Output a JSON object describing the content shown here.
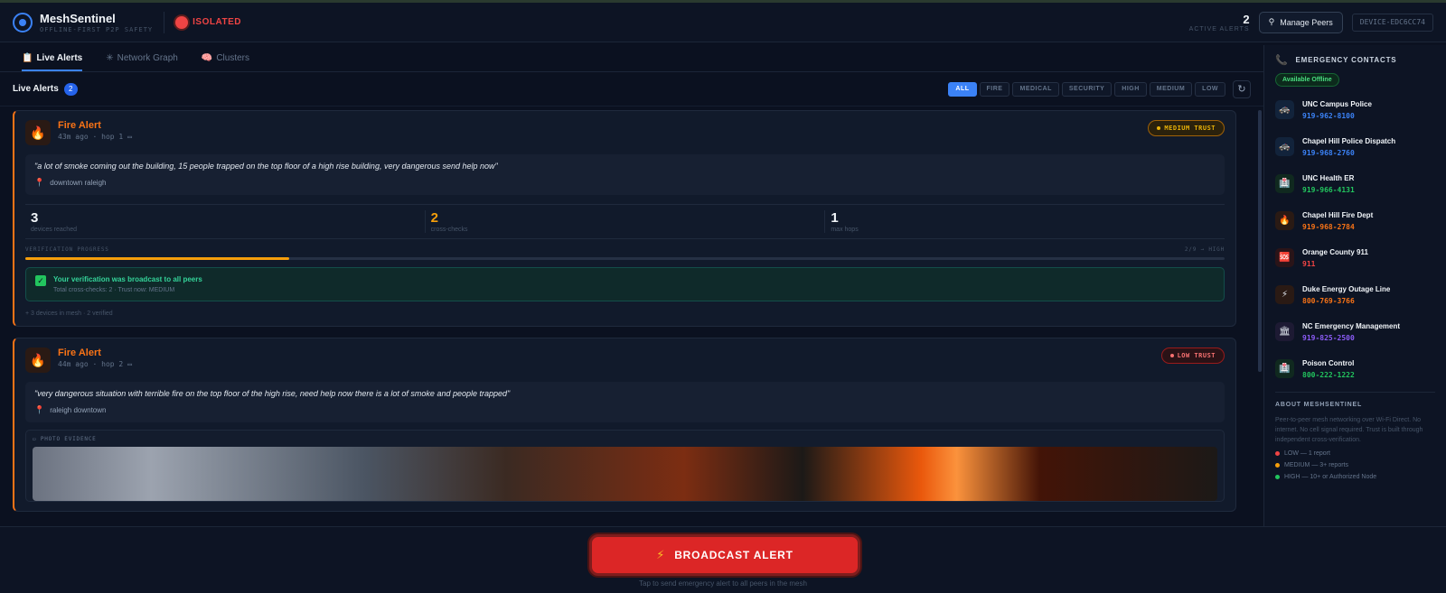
{
  "header": {
    "app_name": "MeshSentinel",
    "tagline": "OFFLINE-FIRST P2P SAFETY",
    "status": "ISOLATED",
    "active_alerts_count": "2",
    "active_alerts_label": "ACTIVE ALERTS",
    "manage_peers": "Manage Peers",
    "device_id": "DEVICE-EDC6CC74"
  },
  "tabs": [
    {
      "icon": "📋",
      "label": "Live Alerts"
    },
    {
      "icon": "✳",
      "label": "Network Graph"
    },
    {
      "icon": "🧠",
      "label": "Clusters"
    }
  ],
  "feed": {
    "title": "Live Alerts",
    "count": "2",
    "filters": [
      "ALL",
      "FIRE",
      "MEDICAL",
      "SECURITY",
      "HIGH",
      "MEDIUM",
      "LOW"
    ],
    "refresh_icon": "↻"
  },
  "alerts": [
    {
      "title": "Fire Alert",
      "meta": "43m ago  ·  hop 1  ▭",
      "trust": "MEDIUM TRUST",
      "message": "\"a lot of smoke coming out the building, 15 people trapped on the top floor of a high rise building, very dangerous send help now\"",
      "location": "downtown raleigh",
      "stats": [
        {
          "value": "3",
          "label": "devices reached"
        },
        {
          "value": "2",
          "label": "cross-checks"
        },
        {
          "value": "1",
          "label": "max hops"
        }
      ],
      "verification_label": "VERIFICATION PROGRESS",
      "verification_value": "2/9 → HIGH",
      "progress_fraction": 0.22,
      "verified_title": "Your verification was broadcast to all peers",
      "verified_sub": "Total cross-checks: 2 · Trust now: MEDIUM",
      "mesh_info": "+ 3 devices in mesh · 2 verified"
    },
    {
      "title": "Fire Alert",
      "meta": "44m ago  ·  hop 2  ▭",
      "trust": "LOW TRUST",
      "message": "\"very dangerous situation with terrible fire on the top floor of the high rise, need help now there is a lot of smoke and people trapped\"",
      "location": "raleigh downtown",
      "photo_label": "▭ PHOTO EVIDENCE"
    }
  ],
  "broadcast": {
    "label": "BROADCAST ALERT",
    "hint": "Tap to send emergency alert to all peers in the mesh"
  },
  "sidebar": {
    "title": "EMERGENCY CONTACTS",
    "availability": "Available Offline",
    "contacts": [
      {
        "name": "UNC Campus Police",
        "number": "919-962-8100",
        "color": "#3b82f6",
        "icon": "🚓",
        "bg": "#12233b"
      },
      {
        "name": "Chapel Hill Police Dispatch",
        "number": "919-968-2760",
        "color": "#3b82f6",
        "icon": "🚓",
        "bg": "#12233b"
      },
      {
        "name": "UNC Health ER",
        "number": "919-966-4131",
        "color": "#22c55e",
        "icon": "🏥",
        "bg": "#10291f"
      },
      {
        "name": "Chapel Hill Fire Dept",
        "number": "919-968-2784",
        "color": "#f97316",
        "icon": "🔥",
        "bg": "#2a1a14"
      },
      {
        "name": "Orange County 911",
        "number": "911",
        "color": "#ef4444",
        "icon": "🆘",
        "bg": "#2a1418"
      },
      {
        "name": "Duke Energy Outage Line",
        "number": "800-769-3766",
        "color": "#f97316",
        "icon": "⚡",
        "bg": "#2a1a14"
      },
      {
        "name": "NC Emergency Management",
        "number": "919-825-2500",
        "color": "#8b5cf6",
        "icon": "🏛",
        "bg": "#1d1a33"
      },
      {
        "name": "Poison Control",
        "number": "800-222-1222",
        "color": "#22c55e",
        "icon": "🏥",
        "bg": "#10291f"
      }
    ],
    "about_title": "ABOUT MESHSENTINEL",
    "about_text": "Peer-to-peer mesh networking over Wi-Fi Direct. No internet. No cell signal required. Trust is built through independent cross-verification.",
    "legend": [
      {
        "text": "LOW — 1 report",
        "color": "#ef4444"
      },
      {
        "text": "MEDIUM — 3+ reports",
        "color": "#f59e0b"
      },
      {
        "text": "HIGH — 10+ or Authorized Node",
        "color": "#22c55e"
      }
    ]
  }
}
